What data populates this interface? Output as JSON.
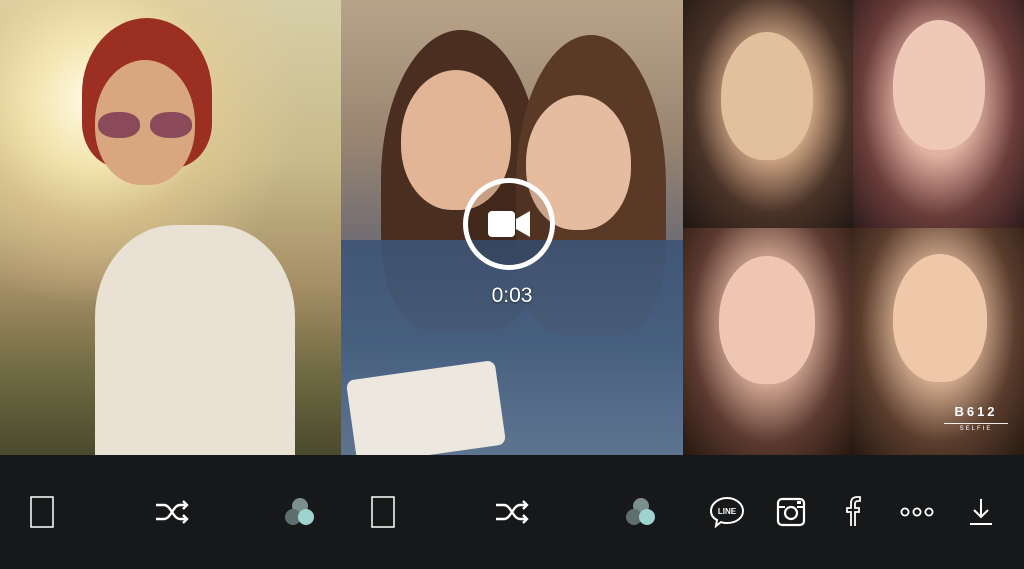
{
  "screen": {
    "background": "#16181a",
    "icon_color": "#ffffff",
    "filter_icon_colors": [
      "#7c8f8e",
      "#5f6f6e",
      "#9fd3cf"
    ]
  },
  "photos": [
    {
      "id": "photo-1",
      "description_icon": "image-icon"
    },
    {
      "id": "photo-2",
      "description_icon": "image-icon"
    },
    {
      "id": "photo-3",
      "description_icon": "image-icon"
    },
    {
      "id": "photo-4",
      "description_icon": "image-icon"
    },
    {
      "id": "photo-5",
      "description_icon": "image-icon"
    },
    {
      "id": "photo-6",
      "description_icon": "image-icon"
    }
  ],
  "video": {
    "icon": "video-camera-icon",
    "duration": "0:03"
  },
  "watermark": {
    "name": "B612",
    "subtitle": "SELFIE"
  },
  "toolbar": {
    "left_group": [
      "frame-icon",
      "shuffle-icon",
      "filter-icon"
    ],
    "middle_group": [
      "frame-icon",
      "shuffle-icon",
      "filter-icon"
    ],
    "share_group": [
      "line-icon",
      "instagram-icon",
      "facebook-icon",
      "more-icon",
      "download-icon"
    ],
    "line_label": "LINE"
  }
}
